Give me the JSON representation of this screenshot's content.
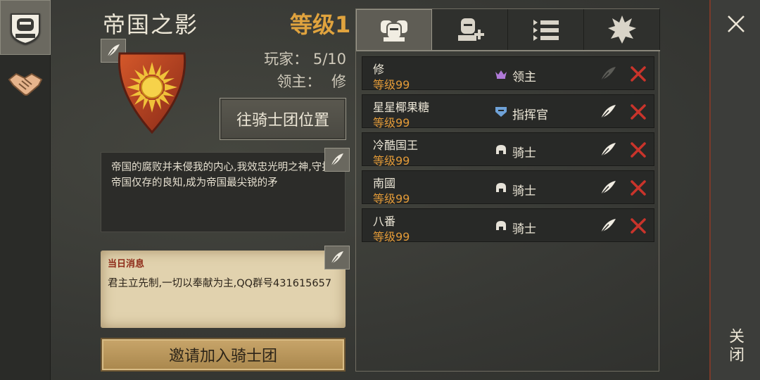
{
  "guild": {
    "name": "帝国之影",
    "level": "等级1",
    "players_label": "玩家：",
    "players_value": "5/10",
    "lord_label": "领主：",
    "lord_value": "修",
    "goto_button": "往骑士团位置",
    "description": "帝国的腐败并未侵我的内心,我效忠光明之神,守护帝国仅存的良知,成为帝国最尖锐的矛",
    "notice_title": "当日消息",
    "notice_text": "君主立先制,一切以奉献为主,QQ群号431615657",
    "invite_button": "邀请加入骑士团"
  },
  "tabs": [
    {
      "icon": "members-helmets-icon",
      "active": true
    },
    {
      "icon": "recruit-knight-icon",
      "active": false
    },
    {
      "icon": "list-icon",
      "active": false
    },
    {
      "icon": "emblem-star-icon",
      "active": false
    }
  ],
  "members": [
    {
      "name": "修",
      "level": "等级99",
      "role": "领主",
      "role_icon": "crown-icon",
      "role_color": "#b07ad8",
      "can_edit": false
    },
    {
      "name": "星星椰果糖",
      "level": "等级99",
      "role": "指挥官",
      "role_icon": "commander-badge-icon",
      "role_color": "#6fa2d8",
      "can_edit": true
    },
    {
      "name": "冷酷国王",
      "level": "等级99",
      "role": "骑士",
      "role_icon": "helmet-icon",
      "role_color": "#e6e2d8",
      "can_edit": true
    },
    {
      "name": "南國",
      "level": "等级99",
      "role": "骑士",
      "role_icon": "helmet-icon",
      "role_color": "#e6e2d8",
      "can_edit": true
    },
    {
      "name": "八番",
      "level": "等级99",
      "role": "骑士",
      "role_icon": "helmet-icon",
      "role_color": "#e6e2d8",
      "can_edit": true
    }
  ],
  "close_label": "关闭",
  "colors": {
    "level_orange": "#e29a38",
    "kick_red": "#c9342b",
    "gold_button": "#c8a56a"
  }
}
